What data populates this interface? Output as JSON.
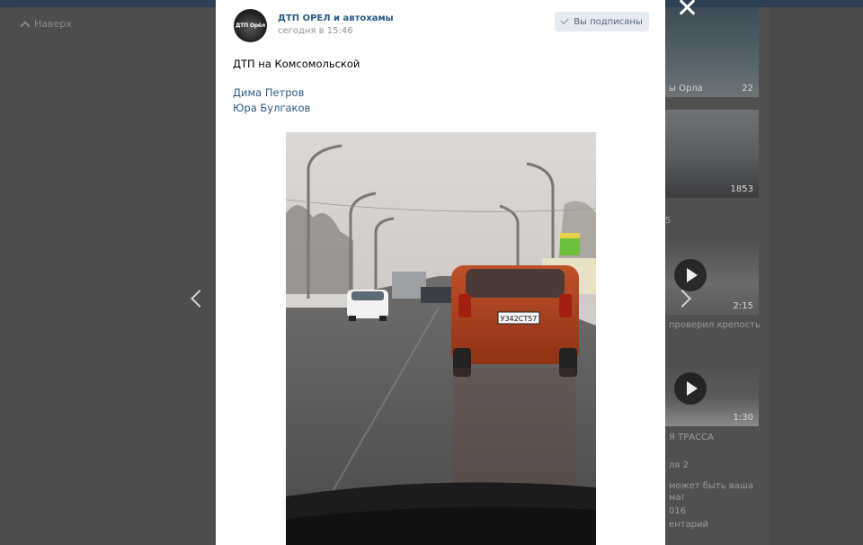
{
  "background": {
    "back_label": "Наверх",
    "sidebar_items": [
      {
        "caption": "ы Орла",
        "duration": "22"
      },
      {
        "duration": "1853"
      },
      {
        "count_label": "5"
      },
      {
        "duration": "2:15"
      },
      {
        "duration": "1:30"
      }
    ],
    "side_texts": {
      "proveril": "проверил крепость",
      "trassa": "Я ТРАССА",
      "ya2": "ля 2",
      "mozhet": "может быть ваша",
      "ma": "ма!",
      "year": "016",
      "comments": "ентарий"
    }
  },
  "post": {
    "author": "ДТП ОРЕЛ и автохамы",
    "avatar_text": "ДТП Орёл",
    "date": "сегодня в 15:46",
    "subscribe_label": "Вы подписаны",
    "text": "ДТП на Комсомольской",
    "mentions": [
      "Дима Петров",
      "Юра Булгаков"
    ],
    "plate": "У342СТ57"
  },
  "icons": {
    "close": "close-icon",
    "prev": "chevron-left-icon",
    "next": "chevron-right-icon",
    "check": "check-icon",
    "back": "chevron-up-icon"
  }
}
